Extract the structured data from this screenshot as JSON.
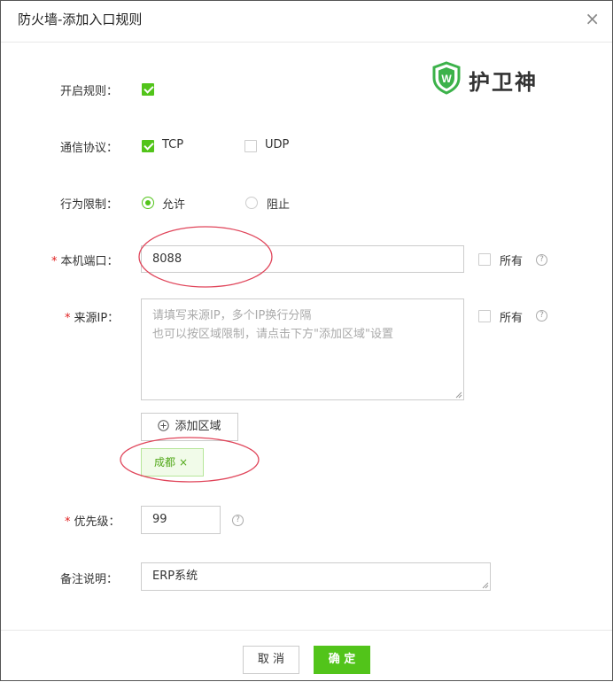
{
  "dialog": {
    "title": "防火墙-添加入口规则",
    "close_label": "×"
  },
  "logo": {
    "text": "护卫神",
    "mark": "W"
  },
  "form": {
    "enable_rule": {
      "label": "开启规则：",
      "checked": true
    },
    "protocol": {
      "label": "通信协议：",
      "options": [
        {
          "label": "TCP",
          "checked": true
        },
        {
          "label": "UDP",
          "checked": false
        }
      ]
    },
    "action": {
      "label": "行为限制：",
      "options": [
        {
          "label": "允许",
          "selected": true
        },
        {
          "label": "阻止",
          "selected": false
        }
      ]
    },
    "local_port": {
      "required_mark": "*",
      "label": "本机端口：",
      "value": "8088",
      "all_label": "所有",
      "all_checked": false
    },
    "source_ip": {
      "required_mark": "*",
      "label": "来源IP：",
      "placeholder_line1": "请填写来源IP，多个IP换行分隔",
      "placeholder_line2": "也可以按区域限制，请点击下方\"添加区域\"设置",
      "all_label": "所有",
      "all_checked": false,
      "add_region_label": "添加区域",
      "regions": [
        {
          "label": "成都",
          "remove": "×"
        }
      ]
    },
    "priority": {
      "required_mark": "*",
      "label": "优先级：",
      "value": "99"
    },
    "remark": {
      "label": "备注说明：",
      "value": "ERP系统"
    }
  },
  "footer": {
    "cancel_label": "取 消",
    "confirm_label": "确 定"
  },
  "colors": {
    "accent": "#52c41a",
    "annotation": "#e0455a"
  }
}
